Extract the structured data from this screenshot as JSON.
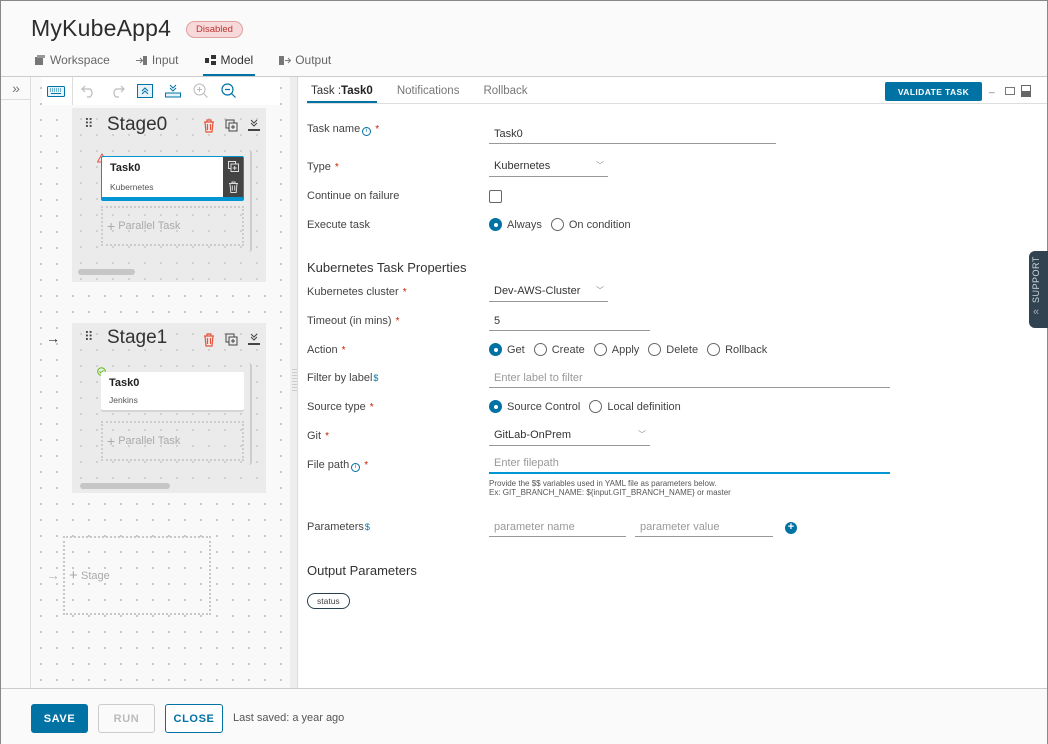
{
  "header": {
    "app_title": "MyKubeApp4",
    "status_badge": "Disabled",
    "tabs": [
      {
        "label": "Workspace",
        "icon": "workspace-icon",
        "active": false
      },
      {
        "label": "Input",
        "icon": "input-icon",
        "active": false
      },
      {
        "label": "Model",
        "icon": "model-icon",
        "active": true
      },
      {
        "label": "Output",
        "icon": "output-icon",
        "active": false
      }
    ]
  },
  "canvas": {
    "rail_toggle": "»",
    "toolbar": [
      "keyboard-icon",
      "undo-icon",
      "redo-icon",
      "collapse-all-icon",
      "expand-all-icon",
      "zoom-in-icon",
      "zoom-out-icon"
    ],
    "stages": [
      {
        "name": "Stage0",
        "tasks": [
          {
            "name": "Task0",
            "type": "Kubernetes",
            "status": "warning",
            "selected": true
          }
        ],
        "parallel_label": "Parallel Task"
      },
      {
        "name": "Stage1",
        "tasks": [
          {
            "name": "Task0",
            "type": "Jenkins",
            "status": "valid",
            "selected": false
          }
        ],
        "parallel_label": "Parallel Task"
      }
    ],
    "add_stage_label": "Stage"
  },
  "panel": {
    "tabs": {
      "task_prefix": "Task :",
      "task_name": "Task0",
      "notifications": "Notifications",
      "rollback": "Rollback"
    },
    "validate_label": "VALIDATE TASK",
    "fields": {
      "task_name": {
        "label": "Task name",
        "value": "Task0"
      },
      "type": {
        "label": "Type",
        "value": "Kubernetes"
      },
      "continue_on_failure": {
        "label": "Continue on failure",
        "checked": false
      },
      "execute_task": {
        "label": "Execute task",
        "options": [
          "Always",
          "On condition"
        ],
        "selected": "Always"
      }
    },
    "k8s_section_title": "Kubernetes Task Properties",
    "k8s": {
      "cluster": {
        "label": "Kubernetes cluster",
        "value": "Dev-AWS-Cluster"
      },
      "timeout": {
        "label": "Timeout (in mins)",
        "value": "5"
      },
      "action": {
        "label": "Action",
        "options": [
          "Get",
          "Create",
          "Apply",
          "Delete",
          "Rollback"
        ],
        "selected": "Get"
      },
      "filter": {
        "label": "Filter by label",
        "placeholder": "Enter label to filter"
      },
      "source_type": {
        "label": "Source type",
        "options": [
          "Source Control",
          "Local definition"
        ],
        "selected": "Source Control"
      },
      "git": {
        "label": "Git",
        "value": "GitLab-OnPrem"
      },
      "file_path": {
        "label": "File path",
        "placeholder": "Enter filepath"
      },
      "help_line1": "Provide the $$ variables used in YAML file as parameters below.",
      "help_line2": "Ex: GIT_BRANCH_NAME: ${input.GIT_BRANCH_NAME} or master",
      "parameters": {
        "label": "Parameters",
        "name_placeholder": "parameter name",
        "value_placeholder": "parameter value"
      }
    },
    "output_section_title": "Output Parameters",
    "output_params": [
      "status"
    ]
  },
  "support_label": "SUPPORT",
  "footer": {
    "save": "SAVE",
    "run": "RUN",
    "close": "CLOSE",
    "last_saved": "Last saved: a year ago"
  },
  "colors": {
    "accent": "#0072a3",
    "danger": "#c92100",
    "success": "#5eb715"
  }
}
